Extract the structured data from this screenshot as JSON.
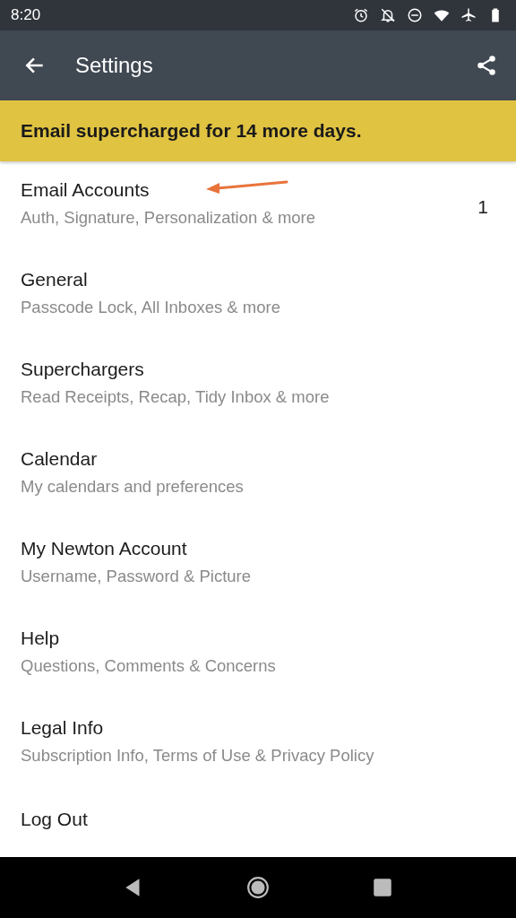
{
  "status_bar": {
    "time": "8:20"
  },
  "app_bar": {
    "title": "Settings"
  },
  "banner": {
    "text": "Email supercharged for 14 more days."
  },
  "items": [
    {
      "title": "Email Accounts",
      "subtitle": "Auth, Signature, Personalization & more",
      "count": "1"
    },
    {
      "title": "General",
      "subtitle": "Passcode Lock, All Inboxes & more"
    },
    {
      "title": "Superchargers",
      "subtitle": "Read Receipts, Recap, Tidy Inbox & more"
    },
    {
      "title": "Calendar",
      "subtitle": "My calendars and preferences"
    },
    {
      "title": "My Newton Account",
      "subtitle": "Username, Password & Picture"
    },
    {
      "title": "Help",
      "subtitle": "Questions, Comments & Concerns"
    },
    {
      "title": "Legal Info",
      "subtitle": "Subscription Info, Terms of Use & Privacy Policy"
    },
    {
      "title": "Log Out"
    }
  ]
}
